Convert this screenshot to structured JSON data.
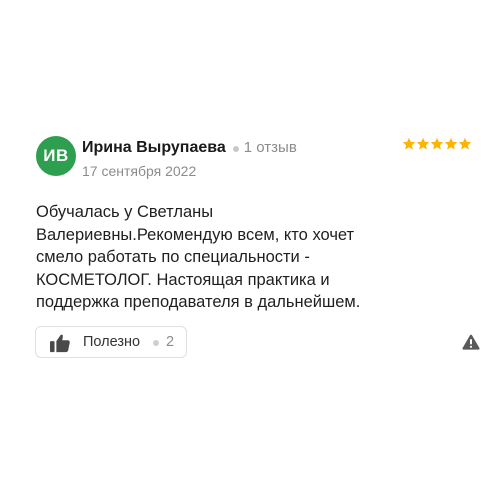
{
  "review": {
    "avatar_initials": "ИВ",
    "avatar_color": "#2e9e4f",
    "author_name": "Ирина Вырупаева",
    "author_reviews_count": "1 отзыв",
    "date": "17 сентября 2022",
    "rating": 5,
    "rating_max": 5,
    "star_color": "#ffb200",
    "text_lines": [
      "Обучалась у Светланы",
      "Валериевны.Рекомендую всем, кто хочет",
      "смело работать по специальности -",
      "КОСМЕТОЛОГ. Настоящая практика и",
      "поддержка преподавателя в дальнейшем."
    ]
  },
  "actions": {
    "helpful_label": "Полезно",
    "helpful_count": "2",
    "thumb_icon": "thumbs-up-icon",
    "report_icon": "warning-triangle-icon"
  }
}
